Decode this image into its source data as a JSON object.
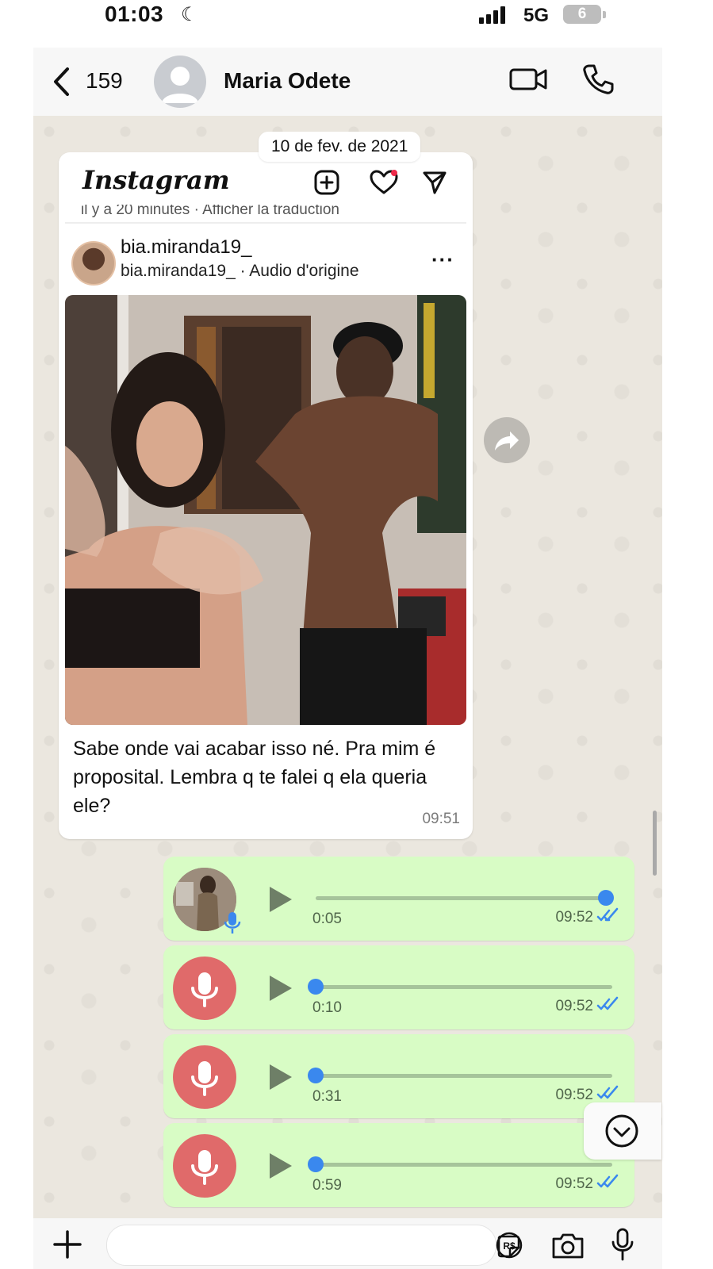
{
  "status_bar": {
    "time": "01:03",
    "moon": "☾",
    "network": "5G",
    "battery": "6"
  },
  "header": {
    "back_count": "159",
    "contact_name": "Maria Odete"
  },
  "date_separator": "10 de fev. de 2021",
  "shared_post": {
    "app_name": "Instagram",
    "cut_line": "il y a 20 minutes · Afficher la traduction",
    "username": "bia.miranda19_",
    "subtitle": "bia.miranda19_ · Audio d'origine",
    "more": "···"
  },
  "incoming_message": {
    "text": "Sabe onde vai acabar isso né.  Pra mim é proposital.  Lembra q te falei q ela queria ele?",
    "time": "09:51"
  },
  "voice_notes": [
    {
      "duration": "0:05",
      "time": "09:52",
      "progress": 1.0,
      "avatar": "photo"
    },
    {
      "duration": "0:10",
      "time": "09:52",
      "progress": 0.0,
      "avatar": "mic-icon"
    },
    {
      "duration": "0:31",
      "time": "09:52",
      "progress": 0.0,
      "avatar": "mic-icon"
    },
    {
      "duration": "0:59",
      "time": "09:52",
      "progress": 0.0,
      "avatar": "mic-icon"
    }
  ],
  "colors": {
    "outgoing_bubble": "#d8fcc5",
    "read_ticks": "#3a88ee",
    "mic_avatar": "#e06a6a"
  }
}
